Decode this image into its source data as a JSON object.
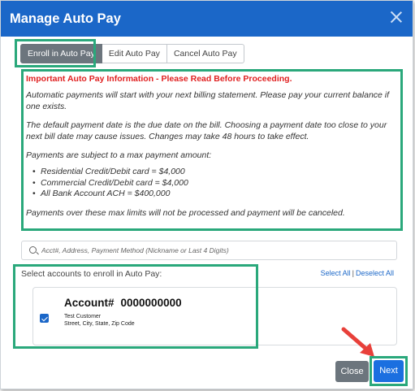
{
  "dialog": {
    "title": "Manage Auto Pay"
  },
  "tabs": [
    {
      "label": "Enroll in Auto Pay"
    },
    {
      "label": "Edit Auto Pay"
    },
    {
      "label": "Cancel Auto Pay"
    }
  ],
  "info": {
    "heading": "Important Auto Pay Information - Please Read Before Proceeding.",
    "p1": "Automatic payments will start with your next billing statement. Please pay your current balance if one exists.",
    "p2": "The default payment date is the due date on the bill. Choosing a payment date too close to your next bill date may cause issues. Changes may take 48 hours to take effect.",
    "p3": "Payments are subject to a max payment amount:",
    "limits": [
      "Residential Credit/Debit card = $4,000",
      "Commercial Credit/Debit card = $4,000",
      "All Bank Account ACH = $400,000"
    ],
    "p4": "Payments over these max limits will not be processed and payment will be canceled."
  },
  "search": {
    "placeholder": "Acct#, Address, Payment Method (Nickname or Last 4 Digits)"
  },
  "accounts_section": {
    "label": "Select accounts to enroll in Auto Pay:",
    "select_all": "Select All",
    "separator": "|",
    "deselect_all": "Deselect All"
  },
  "account": {
    "label": "Account#",
    "number": "0000000000",
    "customer": "Test Customer",
    "address": "Street, City, State, Zip Code",
    "checked": true
  },
  "footer": {
    "close_label": "Close",
    "next_label": "Next"
  },
  "colors": {
    "header": "#1b67c8",
    "highlight": "#2aa87b",
    "important": "#e02020",
    "arrow": "#e8403a"
  },
  "icons": [
    "close-icon",
    "search-icon",
    "checkbox-checked-icon",
    "red-arrow-icon"
  ]
}
